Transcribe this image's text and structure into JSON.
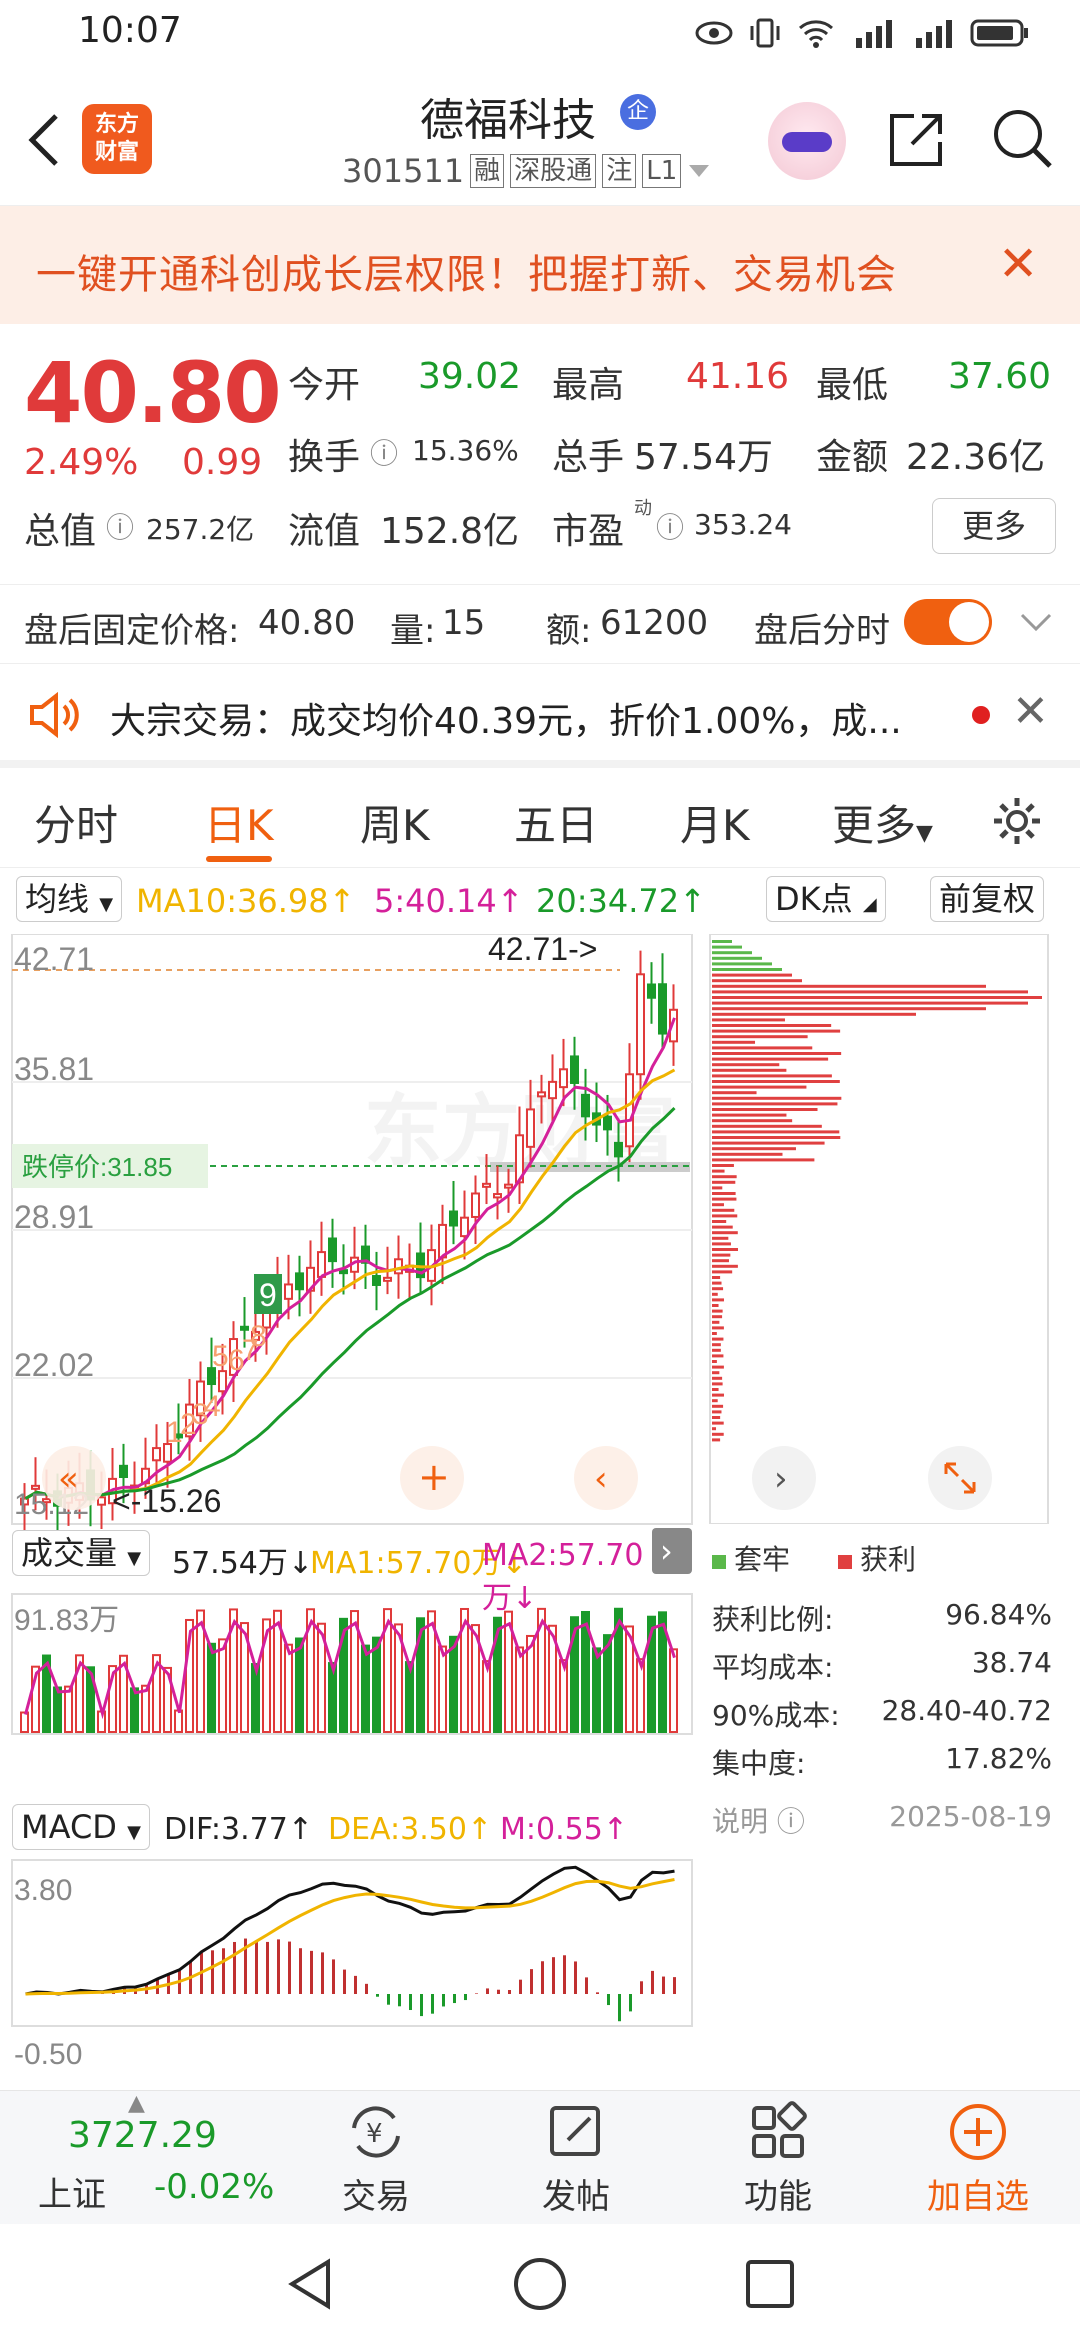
{
  "status_bar": {
    "time": "10:07"
  },
  "header": {
    "logo_line1": "东方",
    "logo_line2": "财富",
    "stock_name": "德福科技",
    "qi_badge": "企",
    "code": "301511",
    "tags": [
      "融",
      "深股通",
      "注",
      "L1"
    ]
  },
  "banner": {
    "text": "一键开通科创成长层权限！把握打新、交易机会"
  },
  "quote": {
    "price": "40.80",
    "change_pct": "2.49%",
    "change_amt": "0.99",
    "open_label": "今开",
    "open": "39.02",
    "high_label": "最高",
    "high": "41.16",
    "low_label": "最低",
    "low": "37.60",
    "turnover_label": "换手",
    "turnover": "15.36%",
    "volume_label": "总手",
    "volume": "57.54万",
    "amount_label": "金额",
    "amount": "22.36亿",
    "mktcap_label": "总值",
    "mktcap": "257.2亿",
    "float_label": "流值",
    "float_cap": "152.8亿",
    "pe_label": "市盈",
    "pe_sup": "动",
    "pe": "353.24",
    "more": "更多"
  },
  "after_hours": {
    "price_label": "盘后固定价格:",
    "price": "40.80",
    "vol_label": "量:",
    "vol": "15",
    "amt_label": "额:",
    "amt": "61200",
    "timeline_label": "盘后分时",
    "toggle_on": true
  },
  "notice": {
    "text": "大宗交易：成交均价40.39元，折价1.00%，成..."
  },
  "tabs": [
    "分时",
    "日K",
    "周K",
    "五日",
    "月K",
    "更多"
  ],
  "active_tab": 1,
  "ma_line": {
    "selector": "均线",
    "ma10": "MA10:36.98↑",
    "ma5": "5:40.14↑",
    "ma20": "20:34.72↑",
    "dk": "DK点",
    "adjust": "前复权"
  },
  "kline": {
    "price_ticks": [
      "42.71",
      "35.81",
      "28.91",
      "22.02"
    ],
    "bottom_label": "15.12",
    "max_marker": "42.71->",
    "min_marker": "<-15.26",
    "limit_down": "跌停价:31.85",
    "watermark": "东方财富",
    "signals": [
      "9",
      "5",
      "6",
      "7",
      "8",
      "1",
      "2",
      "3",
      "4"
    ]
  },
  "volume_bar": {
    "selector": "成交量",
    "vol": "57.54万↓",
    "ma1": "MA1:57.70万↓",
    "ma2": "MA2:57.70万↓",
    "max_tick": "91.83万"
  },
  "macd": {
    "selector": "MACD",
    "dif": "DIF:3.77↑",
    "dea": "DEA:3.50↑",
    "m": "M:0.55↑",
    "top_tick": "3.80",
    "bottom_tick": "-0.50"
  },
  "chips": {
    "legend_trap": "套牢",
    "legend_profit": "获利",
    "rows": [
      {
        "label": "获利比例:",
        "value": "96.84%"
      },
      {
        "label": "平均成本:",
        "value": "38.74"
      },
      {
        "label": "90%成本:",
        "value": "28.40-40.72"
      },
      {
        "label": "集中度:",
        "value": "17.82%"
      }
    ],
    "note_label": "说明",
    "date": "2025-08-19"
  },
  "bottom_nav": {
    "index_value": "3727.29",
    "index_name": "上证",
    "index_change": "-0.02%",
    "items": [
      "交易",
      "发帖",
      "功能",
      "加自选"
    ]
  },
  "colors": {
    "accent": "#f06010",
    "up": "#e03a3a",
    "down": "#1a9a2a",
    "ma5": "#d4209a",
    "ma10": "#f0b400",
    "ma20": "#1a9a2a"
  },
  "icons": [
    "back-icon",
    "share-icon",
    "search-icon",
    "speaker-icon",
    "settings-icon",
    "info-icon"
  ]
}
